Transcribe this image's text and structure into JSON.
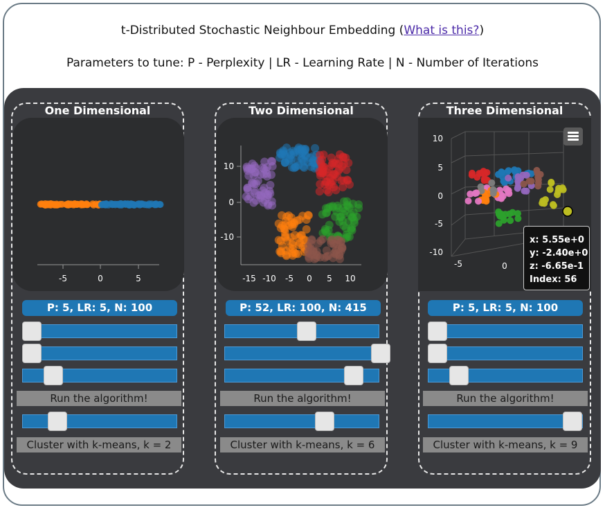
{
  "header": {
    "title_prefix": "t-Distributed Stochastic Neighbour Embedding (",
    "title_link": "What is this?",
    "title_suffix": ")",
    "subtitle": "Parameters to tune: P - Perplexity | LR - Learning Rate | N - Number of Iterations"
  },
  "panels": [
    {
      "title": "One Dimensional",
      "params": "P: 5, LR: 5, N: 100",
      "sliders": [
        0.0,
        0.0,
        0.2
      ],
      "kmeans_slider": 0.22,
      "run_label": "Run the algorithm!",
      "cluster_label": "Cluster with k-means, k = 2",
      "x_ticks": [
        "-5",
        "0",
        "5"
      ]
    },
    {
      "title": "Two Dimensional",
      "params": "P: 52, LR: 100, N: 415",
      "sliders": [
        0.52,
        1.0,
        0.83
      ],
      "kmeans_slider": 0.62,
      "run_label": "Run the algorithm!",
      "cluster_label": "Cluster with k-means, k = 6",
      "x_ticks": [
        "-15",
        "-10",
        "-5",
        "0",
        "5",
        "10"
      ],
      "y_ticks": [
        "10",
        "0",
        "-10"
      ]
    },
    {
      "title": "Three Dimensional",
      "params": "P: 5, LR: 5, N: 100",
      "sliders": [
        0.0,
        0.0,
        0.18
      ],
      "kmeans_slider": 1.0,
      "run_label": "Run the algorithm!",
      "cluster_label": "Cluster with k-means, k = 9",
      "x_ticks": [
        "-5",
        "0"
      ],
      "y_ticks": [
        "10",
        "5",
        "0",
        "-5",
        "-10"
      ],
      "tooltip": {
        "x": "x: 5.55e+0",
        "y": "y: -2.40e+0",
        "z": "z: -6.65e-1",
        "index": "Index: 56"
      }
    }
  ],
  "colors": {
    "blue": "#1f77b4",
    "orange": "#ff7f0e",
    "red": "#d62728",
    "green": "#2ca02c",
    "purple": "#9467bd",
    "brown": "#8c564b",
    "pink": "#e377c2",
    "gray": "#7f7f7f",
    "olive": "#bcbd22"
  }
}
